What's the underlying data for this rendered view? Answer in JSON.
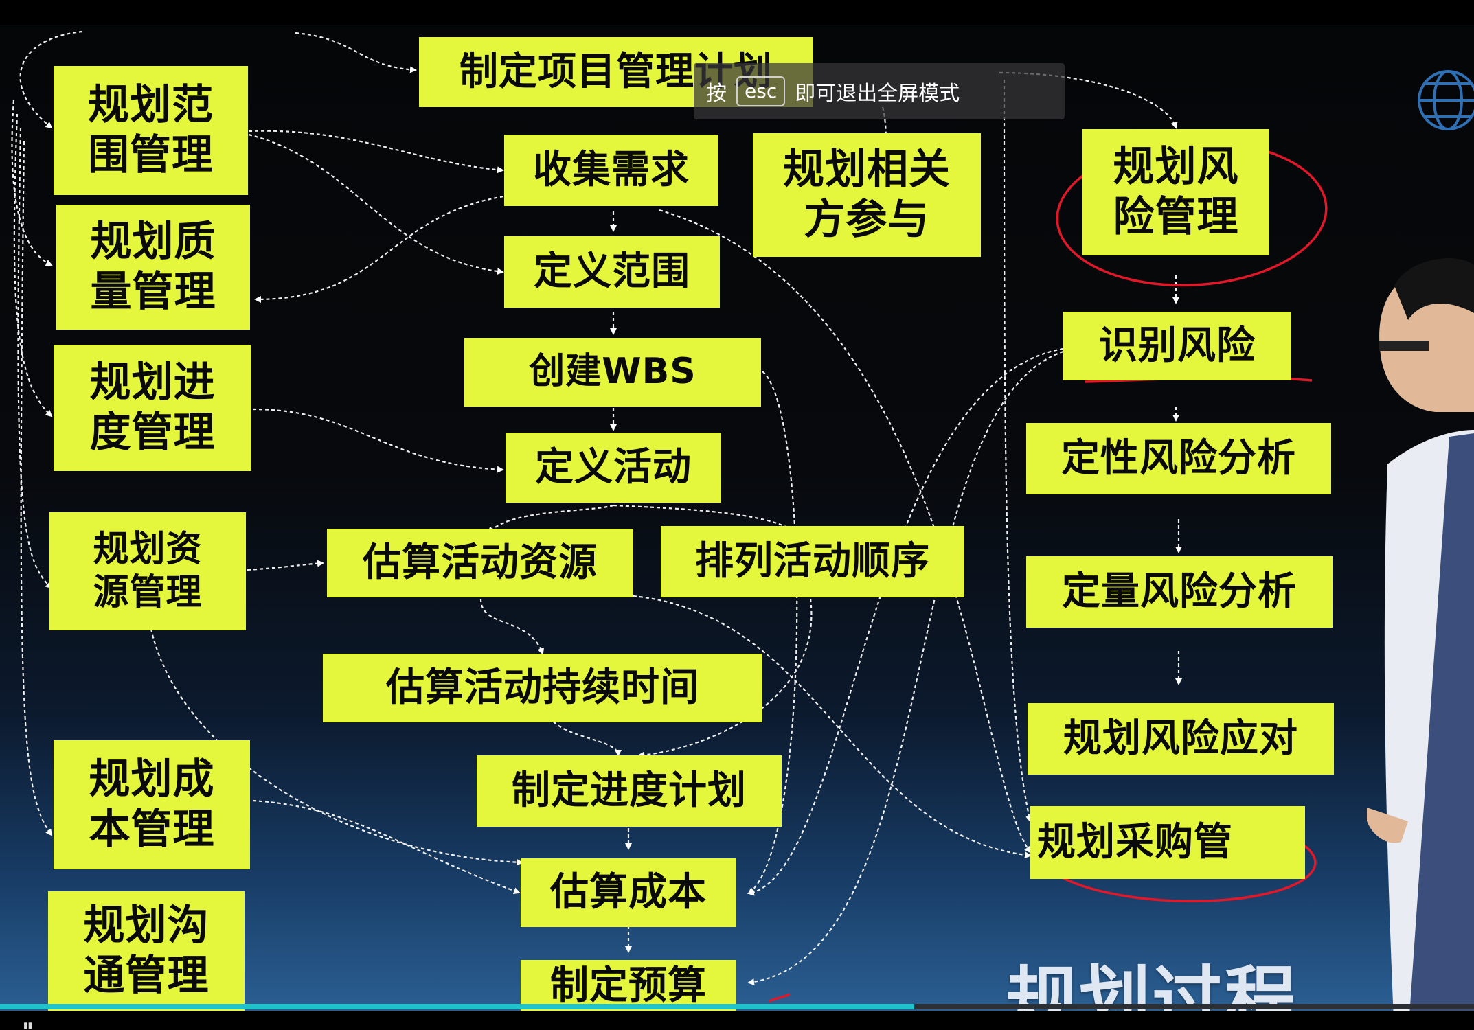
{
  "player": {
    "esc_prefix": "按",
    "esc_key": "esc",
    "esc_suffix": "即可退出全屏模式",
    "progress_fraction": 0.62
  },
  "slide": {
    "section_label": "规划过程组",
    "boxes": {
      "develop_pm_plan": "制定项目管理计划",
      "plan_scope": "规划范围管理",
      "collect_requirements": "收集需求",
      "plan_stakeholder": "规划相关方参与",
      "plan_risk": "规划风险管理",
      "plan_quality": "规划质量管理",
      "define_scope": "定义范围",
      "identify_risks": "识别风险",
      "create_wbs": "创建WBS",
      "plan_schedule": "规划进度管理",
      "define_activities": "定义活动",
      "qualitative_risk": "定性风险分析",
      "plan_resource": "规划资源管理",
      "estimate_resources": "估算活动资源",
      "sequence_activities": "排列活动顺序",
      "quantitative_risk": "定量风险分析",
      "estimate_durations": "估算活动持续时间",
      "plan_cost": "规划成本管理",
      "develop_schedule": "制定进度计划",
      "plan_risk_responses": "规划风险应对",
      "estimate_costs": "估算成本",
      "plan_procurement": "规划采购管",
      "plan_communications": "规划沟通管理",
      "determine_budget": "制定预算"
    }
  },
  "colors": {
    "box_fill": "#e4f73d",
    "box_text": "#0a0a0a",
    "annotation": "#e0182a",
    "progress": "#1fc3c9"
  }
}
